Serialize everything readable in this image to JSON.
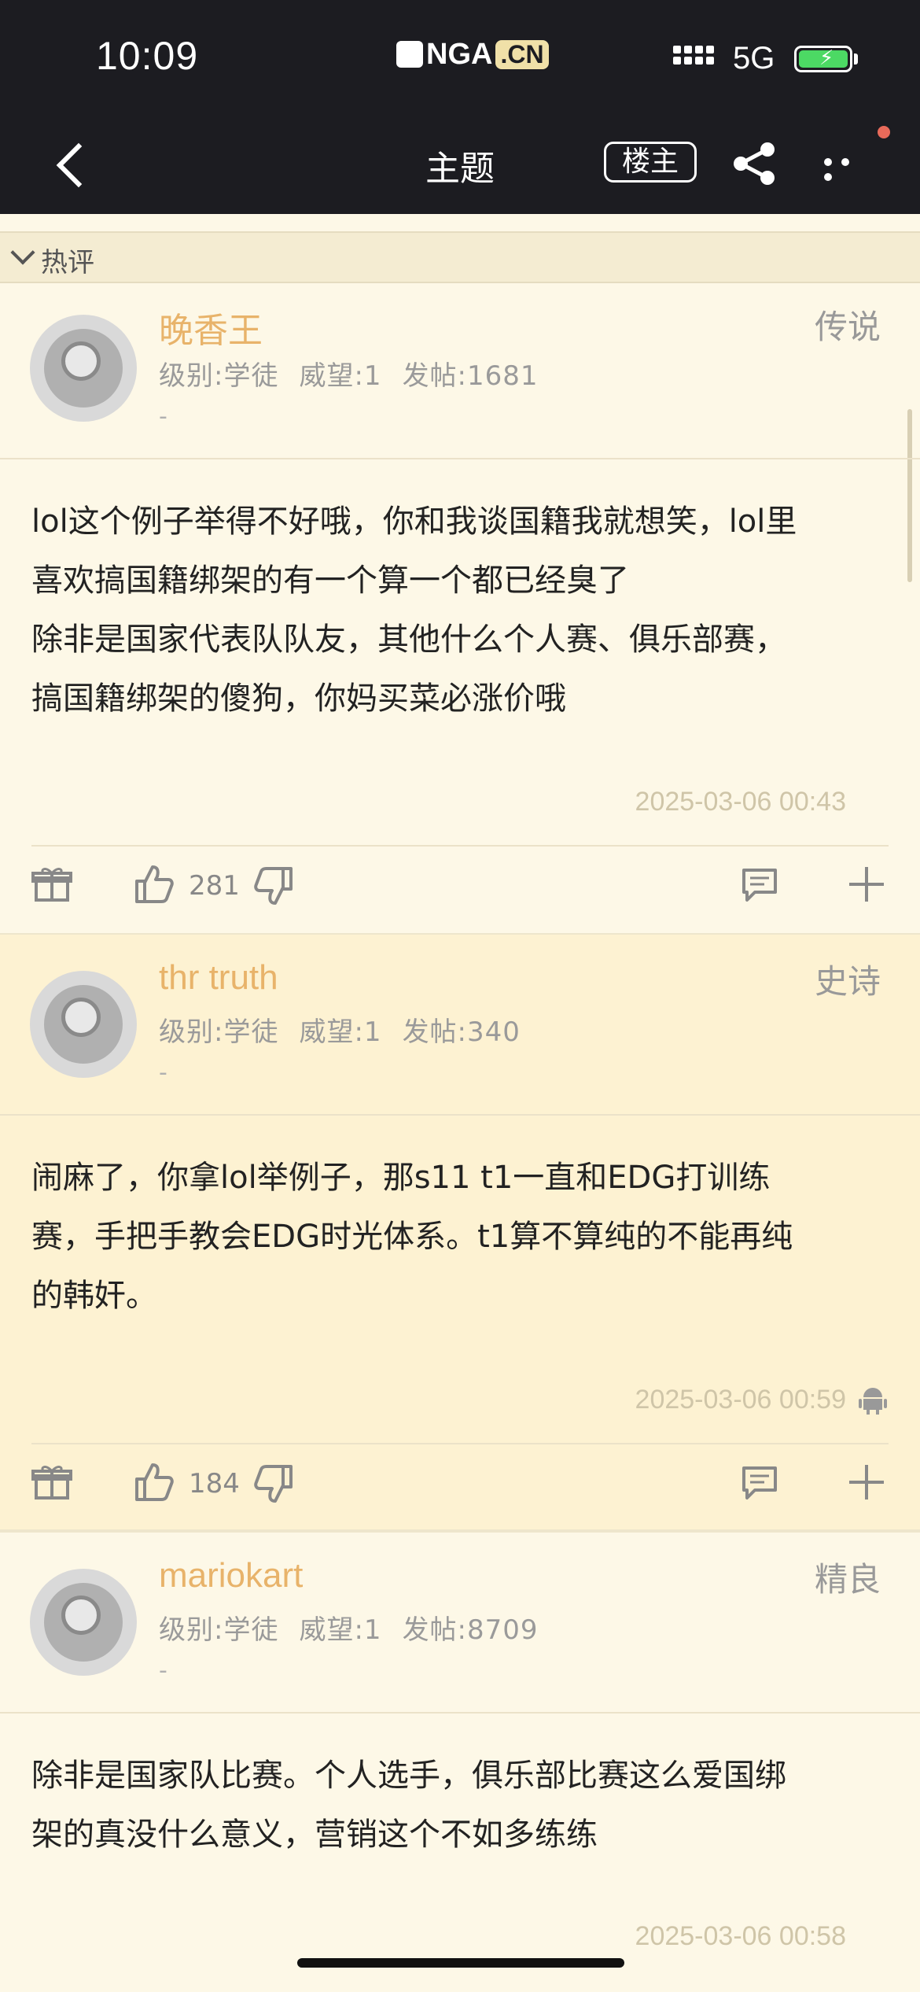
{
  "status": {
    "time": "10:09",
    "network": "5G"
  },
  "app": {
    "logo_text": "NGA",
    "logo_badge": ".CN"
  },
  "nav": {
    "title": "主题",
    "louzhu_label": "楼主"
  },
  "section": {
    "hot_label": "热评"
  },
  "posts": [
    {
      "username": "晚香王",
      "rank": "传说",
      "level": "级别:学徒",
      "prestige": "威望:1",
      "posts": "发帖:1681",
      "dash": "-",
      "lines": [
        "lol这个例子举得不好哦，你和我谈国籍我就想笑，lol里",
        "喜欢搞国籍绑架的有一个算一个都已经臭了",
        "除非是国家代表队队友，其他什么个人赛、俱乐部赛，",
        "搞国籍绑架的傻狗，你妈买菜必涨价哦"
      ],
      "time": "2025-03-06 00:43",
      "likes": "281"
    },
    {
      "username": "thr truth",
      "rank": "史诗",
      "level": "级别:学徒",
      "prestige": "威望:1",
      "posts": "发帖:340",
      "dash": "-",
      "lines": [
        "闹麻了，你拿lol举例子，那s11 t1一直和EDG打训练",
        "赛，手把手教会EDG时光体系。t1算不算纯的不能再纯",
        "的韩奸。"
      ],
      "time": "2025-03-06 00:59",
      "likes": "184"
    },
    {
      "username": "mariokart",
      "rank": "精良",
      "level": "级别:学徒",
      "prestige": "威望:1",
      "posts": "发帖:8709",
      "dash": "-",
      "lines": [
        "除非是国家队比赛。个人选手，俱乐部比赛这么爱国绑",
        "架的真没什么意义，营销这个不如多练练"
      ],
      "time": "2025-03-06 00:58"
    }
  ],
  "colors": {
    "bar": "#1c1c21",
    "background": "#fdf8e7",
    "username": "#e8b36a",
    "battery": "#4cd964"
  }
}
